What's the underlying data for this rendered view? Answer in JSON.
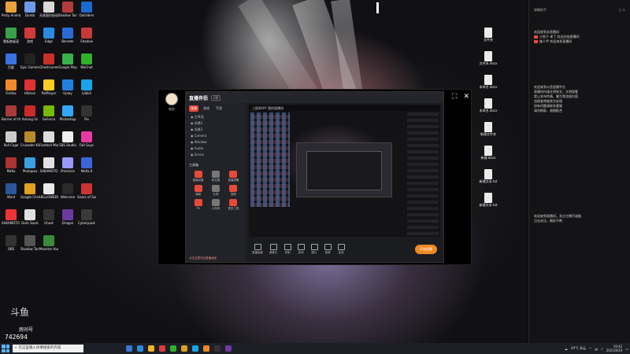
{
  "desktop": {
    "left_icons": [
      {
        "label": "Party Animals",
        "color": "#e9a33a"
      },
      {
        "label": "Dumb",
        "color": "#6a9ae8"
      },
      {
        "label": "无畏契约启动",
        "color": "#d9d9d9"
      },
      {
        "label": "Shadow Tactics",
        "color": "#b53a3a"
      },
      {
        "label": "Outriders",
        "color": "#1a6ad0"
      },
      {
        "label": "看板娘桌宠",
        "color": "#3aa14a"
      },
      {
        "label": "游戏",
        "color": "#d13a3a"
      },
      {
        "label": "Edge",
        "color": "#2a8be0"
      },
      {
        "label": "Blender",
        "color": "#2a6ad8"
      },
      {
        "label": "Shadow",
        "color": "#c43a3a"
      },
      {
        "label": "百度",
        "color": "#3a72e0"
      },
      {
        "label": "Epic Games Launcher",
        "color": "#222"
      },
      {
        "label": "Ghostrunner",
        "color": "#c9302a"
      },
      {
        "label": "Google Play",
        "color": "#3ab04a"
      },
      {
        "label": "WeChat",
        "color": "#31b02a"
      },
      {
        "label": "Firefox",
        "color": "#f28a2a"
      },
      {
        "label": "Hitman",
        "color": "#d33"
      },
      {
        "label": "PotPlayer",
        "color": "#ffcc22"
      },
      {
        "label": "Uplay",
        "color": "#1e83df"
      },
      {
        "label": "bilibili",
        "color": "#1aa3e8"
      },
      {
        "label": "Barrier of the Mind",
        "color": "#aa3a3a"
      },
      {
        "label": "Among Us",
        "color": "#c92a2a"
      },
      {
        "label": "GeForce",
        "color": "#76b900"
      },
      {
        "label": "Photoshop",
        "color": "#31a8ff"
      },
      {
        "label": "Pix",
        "color": "#333"
      },
      {
        "label": "Roll Cage",
        "color": "#ccc"
      },
      {
        "label": "Crusader Kings III",
        "color": "#b88a2a"
      },
      {
        "label": "Football Manager",
        "color": "#ddd"
      },
      {
        "label": "SBS Studio",
        "color": "#eee"
      },
      {
        "label": "Fall Guys",
        "color": "#e43aa0"
      },
      {
        "label": "Mafia",
        "color": "#a33"
      },
      {
        "label": "Photopea",
        "color": "#3aa0e0"
      },
      {
        "label": "SAKAMOTO",
        "color": "#e0e0e0"
      },
      {
        "label": "Premiere",
        "color": "#9999ff"
      },
      {
        "label": "Mafia II",
        "color": "#3a66d8"
      },
      {
        "label": "Word",
        "color": "#2b579a"
      },
      {
        "label": "Google Chrome",
        "color": "#e0a020"
      },
      {
        "label": "HELLOWEEN",
        "color": "#e9e9e9"
      },
      {
        "label": "Welcome",
        "color": "#2a2a2a"
      },
      {
        "label": "Gears of Sonic 2",
        "color": "#c33"
      },
      {
        "label": "SAKAMOTO 2",
        "color": "#e33"
      },
      {
        "label": "Dark Souls",
        "color": "#e0e0e0"
      },
      {
        "label": "Ghost",
        "color": "#333"
      },
      {
        "label": "Dragon",
        "color": "#6a3aa0"
      },
      {
        "label": "Cyberpunk",
        "color": "#3a3a3a"
      },
      {
        "label": "OBS",
        "color": "#333"
      },
      {
        "label": "Shadow Tactics 2",
        "color": "#555"
      },
      {
        "label": "Monster Hunter",
        "color": "#3a8a3a"
      }
    ],
    "right_files": [
      "文件夹",
      "文件夹.docx",
      "未命名.docx",
      "未命名.docx",
      "新建文件夹",
      "新建.docx",
      "新建文本.txt",
      "新建文本.txt"
    ]
  },
  "app_window": {
    "user_name": "电台",
    "title": "直播伴侣",
    "badge": "VIP",
    "side_tabs": [
      "场景",
      "游戏",
      "手游"
    ],
    "scene_rows": [
      "主界面",
      "场景2",
      "场景3",
      "Camera",
      "Window",
      "Audio",
      "Scene"
    ],
    "tools_title": "工具箱",
    "tools": [
      {
        "label": "直播设置",
        "color": "#e84a3a"
      },
      {
        "label": "粉丝团",
        "color": "#777"
      },
      {
        "label": "直播提醒",
        "color": "#e84a3a"
      },
      {
        "label": "弹幕",
        "color": "#e84a3a"
      },
      {
        "label": "礼物",
        "color": "#777"
      },
      {
        "label": "美颜",
        "color": "#e84a3a"
      },
      {
        "label": "PK",
        "color": "#e84a3a"
      },
      {
        "label": "小游戏",
        "color": "#777"
      },
      {
        "label": "更多工具",
        "color": "#e84a3a"
      }
    ],
    "side_bottom": "点击这里开启直播画面",
    "preview_header": "三国杀DIY 我的直播间",
    "bottom_bar": [
      "直播画面",
      "摄像头",
      "录制",
      "游戏",
      "图片",
      "音频",
      "连线"
    ],
    "start_live": "开始直播"
  },
  "chat": {
    "header": "弹幕助手",
    "top_lines": [
      "欢迎来到本直播间",
      "小鱼干 来了 欢迎光临直播间",
      "路人甲 欢迎来到直播间"
    ],
    "system_lines": [
      "欢迎来到斗鱼直播平台",
      "直播间内请文明发言，文明观看",
      "禁止发布色情、暴力等违规内容",
      "违规者将被禁言处理",
      "如有问题请联系客服",
      "请勿刷屏，谢谢配合"
    ],
    "bottom_lines": [
      "欢迎来到直播间，关注主播不迷路",
      "点击关注，精彩不断"
    ]
  },
  "overlay": {
    "logo": "斗鱼",
    "room_label": "房间号",
    "room_number": "742694"
  },
  "taskbar": {
    "search_placeholder": "在这里输入你要搜索的内容",
    "weather": "29°C 多云",
    "time": "19:42",
    "date": "2021/8/19"
  }
}
